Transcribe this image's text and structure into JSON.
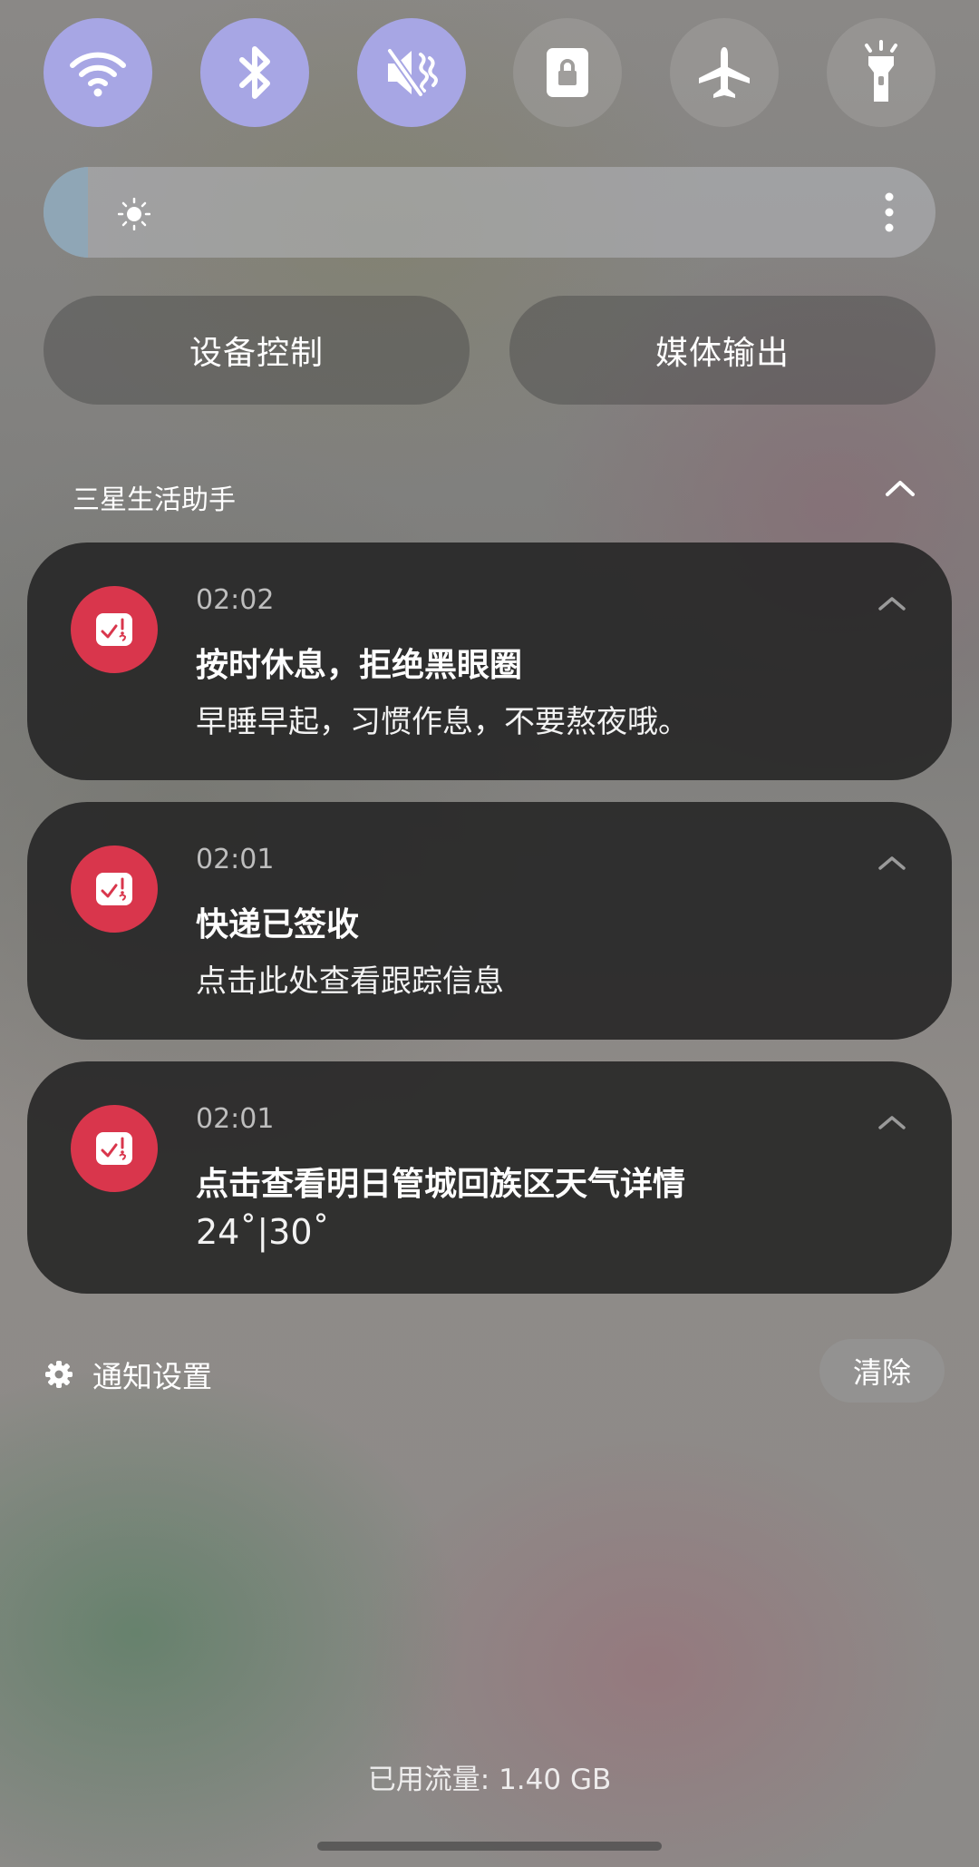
{
  "quick_settings": {
    "toggles": [
      {
        "icon": "wifi-icon",
        "state": "on"
      },
      {
        "icon": "bluetooth-icon",
        "state": "on"
      },
      {
        "icon": "sound-mute-icon",
        "state": "on"
      },
      {
        "icon": "rotation-lock-icon",
        "state": "off"
      },
      {
        "icon": "airplane-icon",
        "state": "off"
      },
      {
        "icon": "flashlight-icon",
        "state": "off"
      }
    ],
    "brightness_level": 0.05,
    "device_control_label": "设备控制",
    "media_output_label": "媒体输出"
  },
  "notification_group": {
    "app_name": "三星生活助手",
    "notifications": [
      {
        "time": "02:02",
        "title": "按时休息，拒绝黑眼圈",
        "body": "早睡早起，习惯作息，不要熬夜哦。"
      },
      {
        "time": "02:01",
        "title": "快递已签收",
        "body": "点击此处查看跟踪信息"
      },
      {
        "time": "02:01",
        "title": "点击查看明日管城回族区天气详情",
        "body": "24˚|30˚"
      }
    ]
  },
  "footer": {
    "notification_settings_label": "通知设置",
    "clear_label": "清除",
    "data_usage": "已用流量: 1.40 GB"
  },
  "colors": {
    "toggle_on": "#a7a6e4",
    "app_icon": "#d9364c",
    "card_bg": "#262626"
  }
}
